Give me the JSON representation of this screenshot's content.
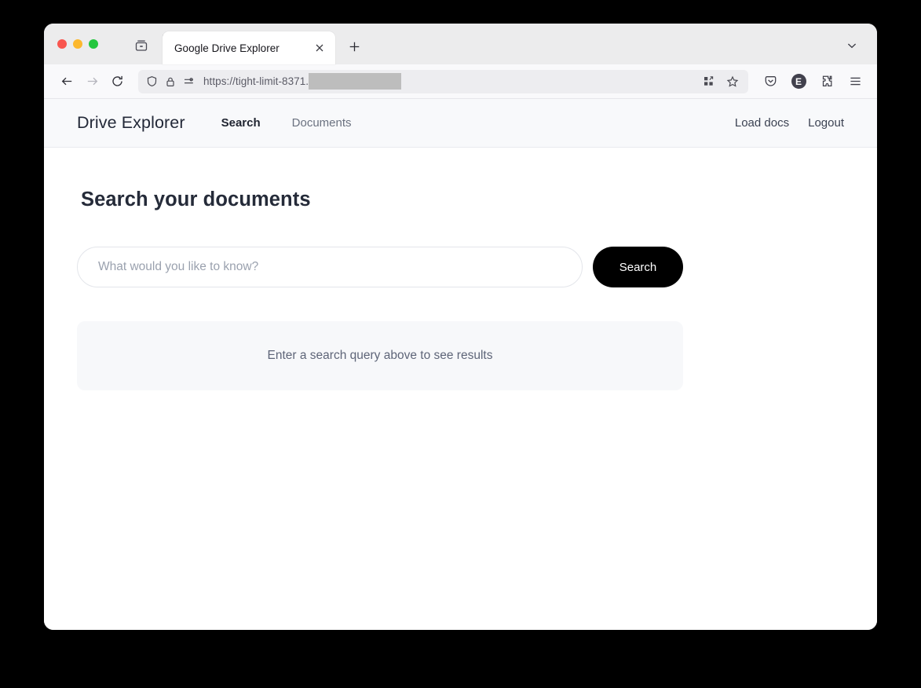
{
  "browser": {
    "window_controls": [
      "close",
      "minimize",
      "maximize"
    ],
    "tab_list_icon": "tab-list-icon",
    "tab": {
      "title": "Google Drive Explorer",
      "close_icon": "close-icon"
    },
    "new_tab_icon": "plus-icon",
    "tabstrip_chevron_icon": "chevron-down-icon",
    "toolbar": {
      "back_icon": "back-arrow-icon",
      "forward_icon": "forward-arrow-icon",
      "reload_icon": "reload-icon",
      "shield_icon": "shield-icon",
      "lock_icon": "lock-icon",
      "permissions_icon": "permissions-icon",
      "url_text": "https://tight-limit-8371.",
      "url_redacted": true,
      "split_view_icon": "grid-expand-icon",
      "bookmark_icon": "star-icon",
      "pocket_icon": "pocket-icon",
      "account_initial": "E",
      "extensions_icon": "puzzle-icon",
      "menu_icon": "hamburger-menu-icon"
    }
  },
  "app": {
    "brand": "Drive Explorer",
    "nav_links": [
      {
        "label": "Search",
        "active": true
      },
      {
        "label": "Documents",
        "active": false
      }
    ],
    "nav_right": [
      {
        "label": "Load docs"
      },
      {
        "label": "Logout"
      }
    ],
    "page_title": "Search your documents",
    "search": {
      "placeholder": "What would you like to know?",
      "value": "",
      "button_label": "Search"
    },
    "results": {
      "empty_message": "Enter a search query above to see results"
    },
    "colors": {
      "accent": "#000000",
      "nav_background": "#f8f9fb",
      "panel_background": "#f7f8fa",
      "title_text": "#252b39",
      "muted_text": "#6b7280"
    }
  }
}
